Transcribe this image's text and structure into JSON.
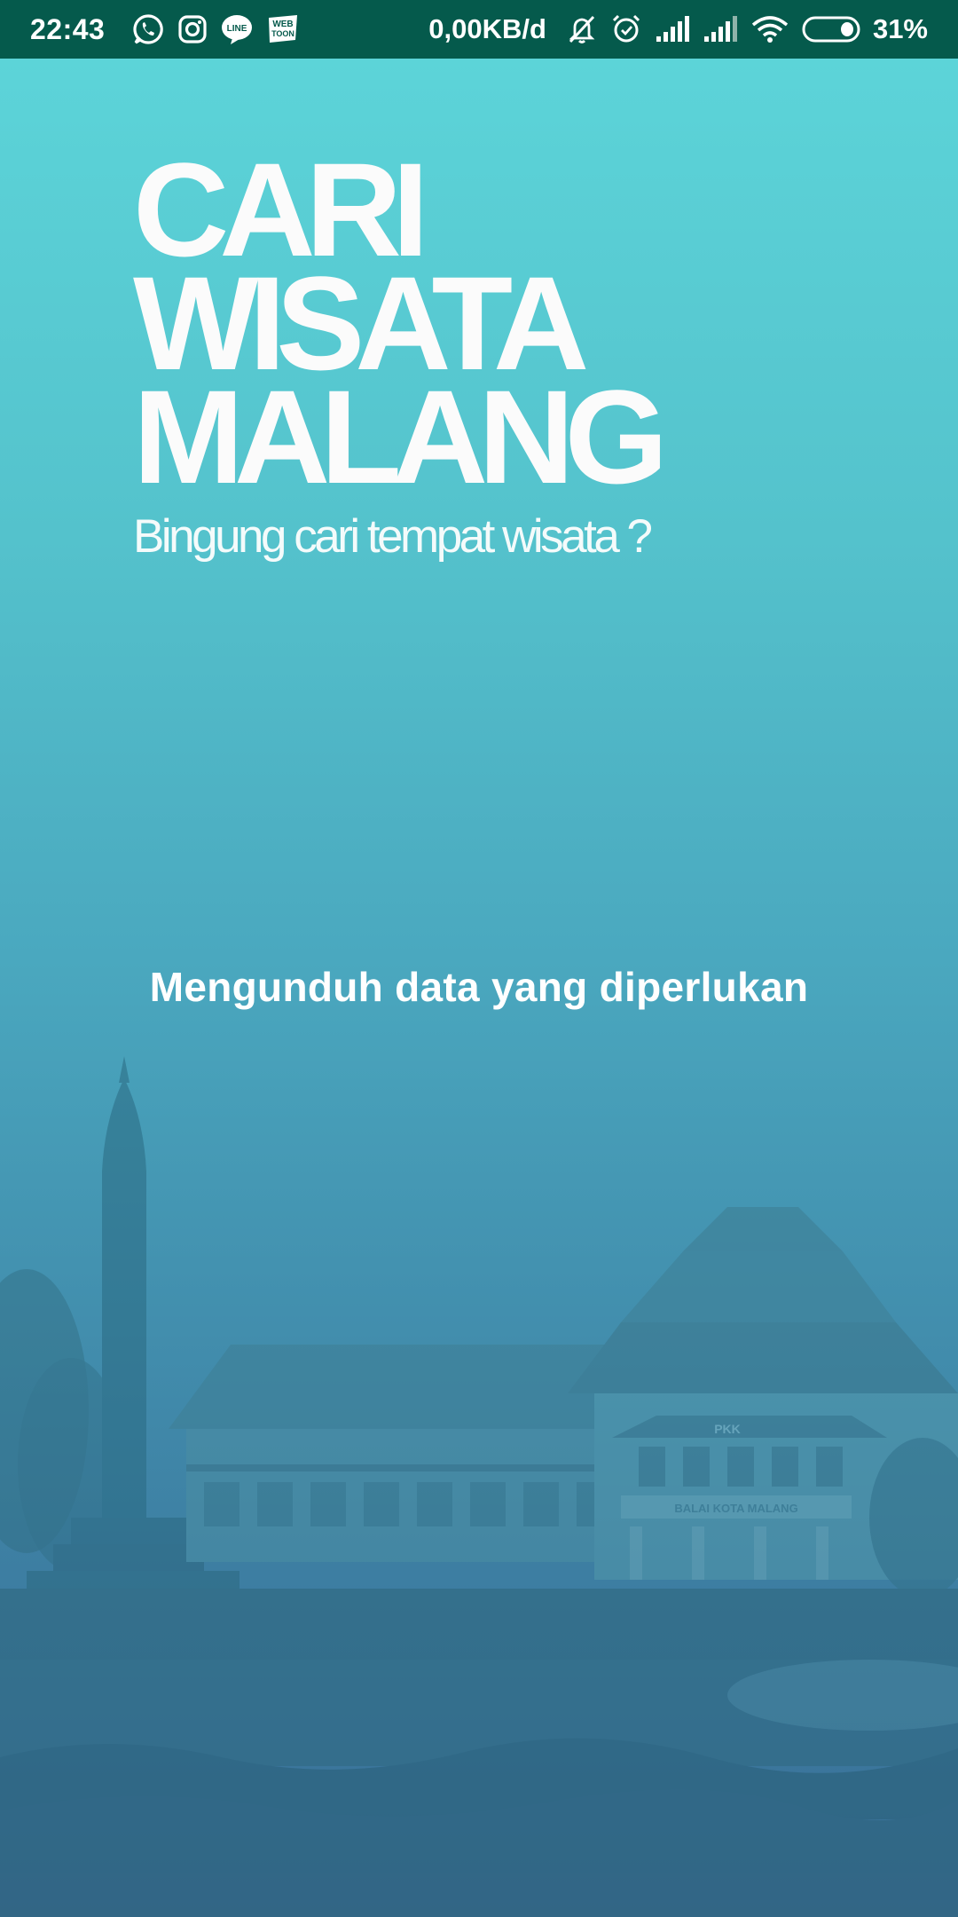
{
  "status_bar": {
    "time": "22:43",
    "network_speed": "0,00KB/d",
    "battery_percent": "31%",
    "notification_icons": [
      "whatsapp-icon",
      "instagram-icon",
      "line-icon",
      "webtoon-icon"
    ],
    "webtoon_label_top": "WEB",
    "webtoon_label_bottom": "TOON",
    "line_label": "LINE",
    "system_icons": [
      "muted-bell-icon",
      "alarm-icon",
      "signal-1-icon",
      "signal-2-icon",
      "wifi-icon",
      "battery-icon"
    ],
    "background_color": "#055a4c"
  },
  "splash": {
    "title_lines": [
      "CARI",
      "WISATA",
      "MALANG"
    ],
    "tagline": "Bingung cari tempat wisata ?",
    "loading_message": "Mengunduh data yang diperlukan",
    "gradient_top": "#5dd6da",
    "gradient_bottom": "#3a6f97"
  },
  "scenery": {
    "building_sign": "BALAI KOTA MALANG",
    "roof_sign": "PKK"
  }
}
